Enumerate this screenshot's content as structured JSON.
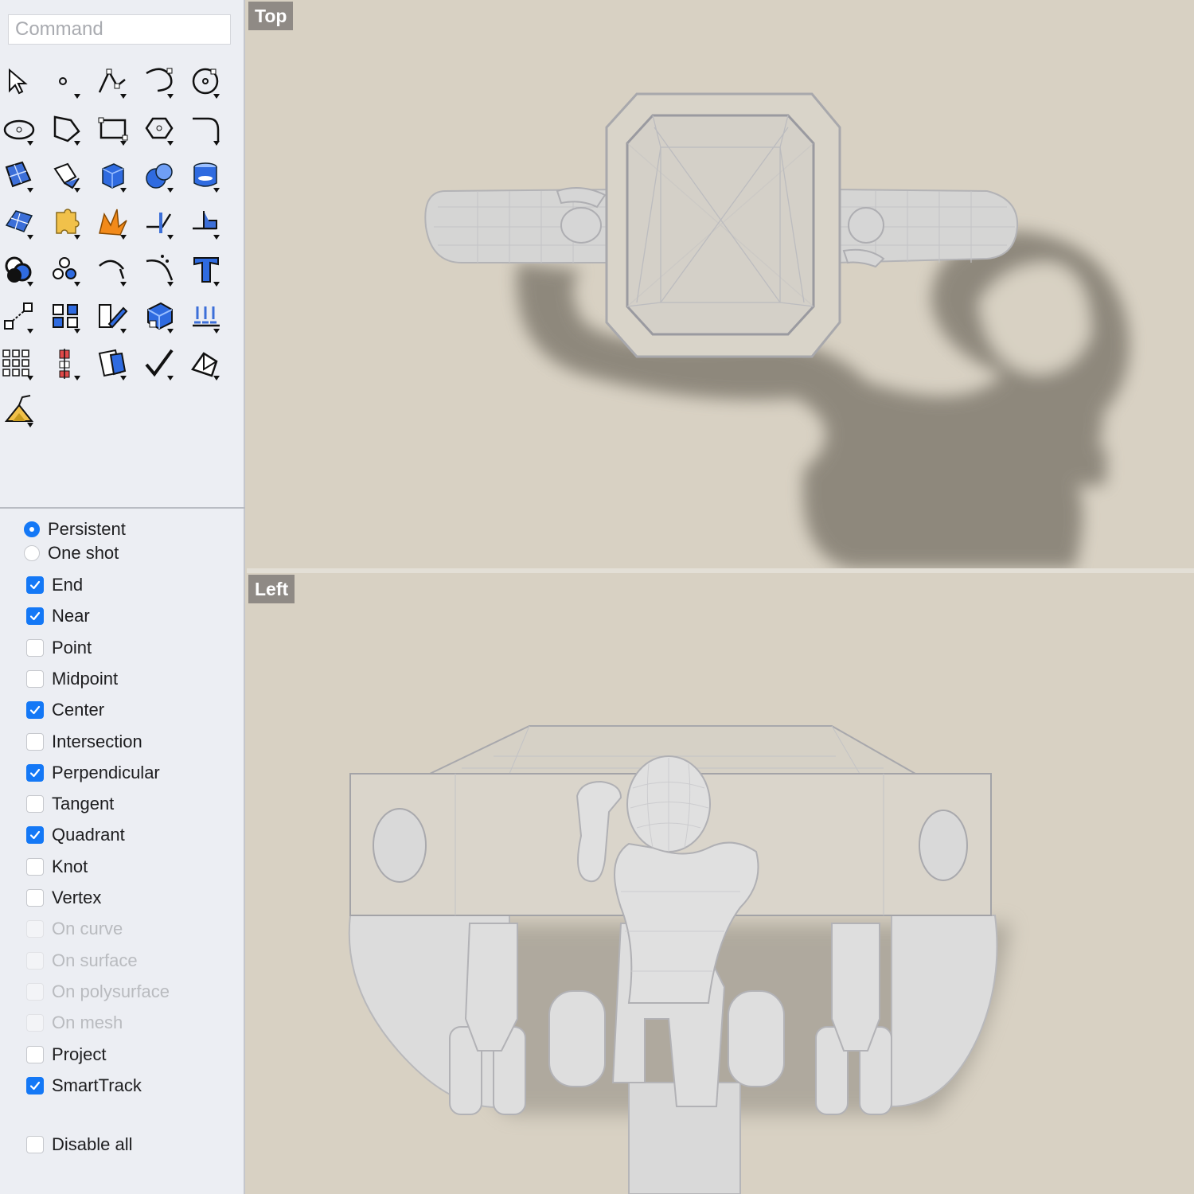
{
  "command": {
    "placeholder": "Command"
  },
  "toolbar": {
    "tools": [
      "select-arrow-icon",
      "point-icon",
      "polyline-icon",
      "curve-icon",
      "circle-icon",
      "ellipse-icon",
      "polygon-icon",
      "rectangle-icon",
      "hexagon-icon",
      "fillet-curve-icon",
      "surface-from-points-icon",
      "extrude-surface-icon",
      "box-icon",
      "sphere-icon",
      "cylinder-icon",
      "mesh-icon",
      "puzzle-icon",
      "explode-icon",
      "trim-icon",
      "split-icon",
      "boolean-union-icon",
      "points-cloud-icon",
      "offset-curve-icon",
      "blend-curve-icon",
      "text-icon",
      "move-icon",
      "group-icon",
      "transform-icon",
      "solid-edit-icon",
      "array-icon",
      "grid-array-icon",
      "dimension-icon",
      "layer-icon",
      "check-icon",
      "analyze-icon",
      "render-icon"
    ]
  },
  "osnap": {
    "mode_persistent": "Persistent",
    "mode_oneshot": "One shot",
    "mode_selected": "persistent",
    "items": [
      {
        "label": "End",
        "checked": true,
        "enabled": true
      },
      {
        "label": "Near",
        "checked": true,
        "enabled": true
      },
      {
        "label": "Point",
        "checked": false,
        "enabled": true
      },
      {
        "label": "Midpoint",
        "checked": false,
        "enabled": true
      },
      {
        "label": "Center",
        "checked": true,
        "enabled": true
      },
      {
        "label": "Intersection",
        "checked": false,
        "enabled": true
      },
      {
        "label": "Perpendicular",
        "checked": true,
        "enabled": true
      },
      {
        "label": "Tangent",
        "checked": false,
        "enabled": true
      },
      {
        "label": "Quadrant",
        "checked": true,
        "enabled": true
      },
      {
        "label": "Knot",
        "checked": false,
        "enabled": true
      },
      {
        "label": "Vertex",
        "checked": false,
        "enabled": true
      },
      {
        "label": "On curve",
        "checked": false,
        "enabled": false
      },
      {
        "label": "On surface",
        "checked": false,
        "enabled": false
      },
      {
        "label": "On polysurface",
        "checked": false,
        "enabled": false
      },
      {
        "label": "On mesh",
        "checked": false,
        "enabled": false
      },
      {
        "label": "Project",
        "checked": false,
        "enabled": true
      },
      {
        "label": "SmartTrack",
        "checked": true,
        "enabled": true
      }
    ],
    "disable_all": "Disable all"
  },
  "viewports": {
    "top_title": "Top",
    "left_title": "Left"
  },
  "colors": {
    "accent": "#1478f6",
    "viewport_bg": "#d8d1c3",
    "sidebar_bg": "#eceef3"
  }
}
